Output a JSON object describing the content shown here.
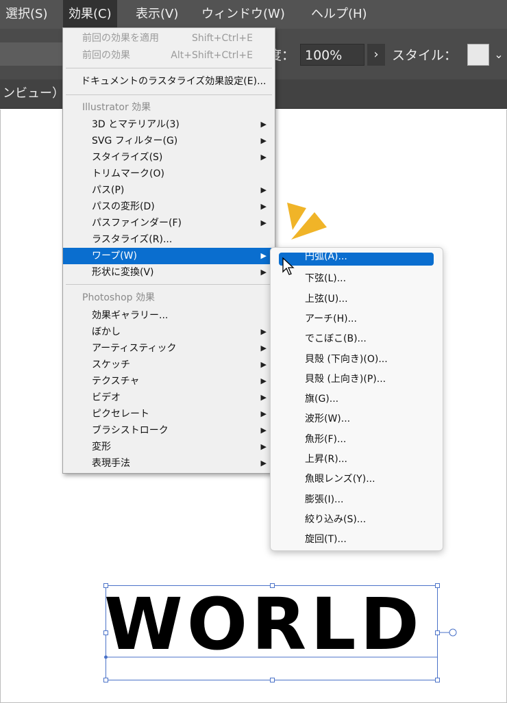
{
  "menubar": {
    "items": [
      "選択(S)",
      "効果(C)",
      "表示(V)",
      "ウィンドウ(W)",
      "ヘルプ(H)"
    ],
    "active_index": 1
  },
  "control_bar": {
    "opacity_label": "度：",
    "opacity_value": "100%",
    "opacity_arrow": "›",
    "style_label": "スタイル：",
    "style_chevron": "⌄"
  },
  "tab_row": {
    "label": "ンビュー）"
  },
  "effect_menu": {
    "apply_last": {
      "label": "前回の効果を適用",
      "shortcut": "Shift+Ctrl+E"
    },
    "last_effect": {
      "label": "前回の効果",
      "shortcut": "Alt+Shift+Ctrl+E"
    },
    "raster_settings": "ドキュメントのラスタライズ効果設定(E)...",
    "illustrator_section": "Illustrator 効果",
    "illustrator_items": [
      {
        "label": "3D とマテリアル(3)",
        "submenu": true
      },
      {
        "label": "SVG フィルター(G)",
        "submenu": true
      },
      {
        "label": "スタイライズ(S)",
        "submenu": true
      },
      {
        "label": "トリムマーク(O)",
        "submenu": false
      },
      {
        "label": "パス(P)",
        "submenu": true
      },
      {
        "label": "パスの変形(D)",
        "submenu": true
      },
      {
        "label": "パスファインダー(F)",
        "submenu": true
      },
      {
        "label": "ラスタライズ(R)...",
        "submenu": false
      },
      {
        "label": "ワープ(W)",
        "submenu": true,
        "highlighted": true
      },
      {
        "label": "形状に変換(V)",
        "submenu": true
      }
    ],
    "photoshop_section": "Photoshop 効果",
    "photoshop_items": [
      {
        "label": "効果ギャラリー...",
        "submenu": false
      },
      {
        "label": "ぼかし",
        "submenu": true
      },
      {
        "label": "アーティスティック",
        "submenu": true
      },
      {
        "label": "スケッチ",
        "submenu": true
      },
      {
        "label": "テクスチャ",
        "submenu": true
      },
      {
        "label": "ビデオ",
        "submenu": true
      },
      {
        "label": "ピクセレート",
        "submenu": true
      },
      {
        "label": "ブラシストローク",
        "submenu": true
      },
      {
        "label": "変形",
        "submenu": true
      },
      {
        "label": "表現手法",
        "submenu": true
      }
    ],
    "arrow_glyph": "▶"
  },
  "warp_menu": {
    "items": [
      "円弧(A)...",
      "下弦(L)...",
      "上弦(U)...",
      "アーチ(H)...",
      "でこぼこ(B)...",
      "貝殻 (下向き)(O)...",
      "貝殻 (上向き)(P)...",
      "旗(G)...",
      "波形(W)...",
      "魚形(F)...",
      "上昇(R)...",
      "魚眼レンズ(Y)...",
      "膨張(I)...",
      "絞り込み(S)...",
      "旋回(T)..."
    ],
    "highlighted_index": 0
  },
  "artboard": {
    "text": "WORLD"
  },
  "colors": {
    "highlight": "#0a6ecf",
    "accent_rays": "#f0b428",
    "selection": "#4a72c8"
  }
}
